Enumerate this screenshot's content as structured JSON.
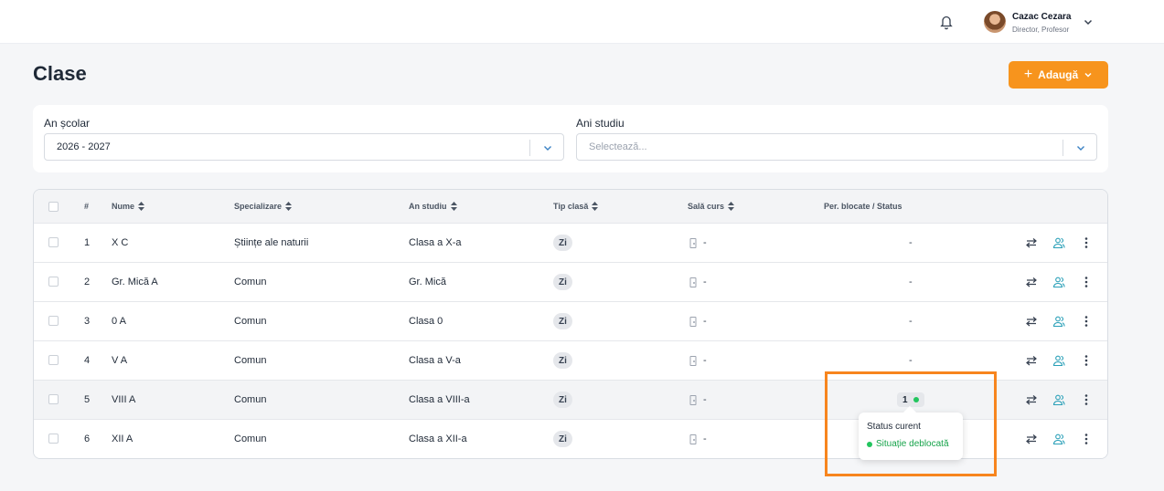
{
  "header": {
    "user_name": "Cazac Cezara",
    "user_role": "Director, Profesor",
    "icons": {
      "notifications": "bell-icon",
      "user_menu": "chevron-down-icon"
    }
  },
  "page": {
    "title": "Clase",
    "add_label": "Adaugă"
  },
  "filters": {
    "school_year": {
      "label": "An școlar",
      "value": "2026 - 2027"
    },
    "study_years": {
      "label": "Ani studiu",
      "placeholder": "Selectează..."
    }
  },
  "table": {
    "columns": {
      "index": "#",
      "name": "Nume",
      "specialization": "Specializare",
      "study_year": "An studiu",
      "class_type": "Tip clasă",
      "room": "Sală curs",
      "status": "Per. blocate / Status"
    },
    "rows": [
      {
        "index": "1",
        "name": "X C",
        "specialization": "Științe ale naturii",
        "study_year": "Clasa a X-a",
        "class_type": "Zi",
        "room": "-",
        "status": "-"
      },
      {
        "index": "2",
        "name": "Gr. Mică A",
        "specialization": "Comun",
        "study_year": "Gr. Mică",
        "class_type": "Zi",
        "room": "-",
        "status": "-"
      },
      {
        "index": "3",
        "name": "0 A",
        "specialization": "Comun",
        "study_year": "Clasa 0",
        "class_type": "Zi",
        "room": "-",
        "status": "-"
      },
      {
        "index": "4",
        "name": "V A",
        "specialization": "Comun",
        "study_year": "Clasa a V-a",
        "class_type": "Zi",
        "room": "-",
        "status": "-"
      },
      {
        "index": "5",
        "name": "VIII A",
        "specialization": "Comun",
        "study_year": "Clasa a VIII-a",
        "class_type": "Zi",
        "room": "-",
        "status_count": "1"
      },
      {
        "index": "6",
        "name": "XII A",
        "specialization": "Comun",
        "study_year": "Clasa a XII-a",
        "class_type": "Zi",
        "room": "-",
        "status": "-"
      }
    ]
  },
  "tooltip": {
    "title": "Status curent",
    "status": "Situație deblocată",
    "status_color": "#16a34a"
  },
  "colors": {
    "accent": "#f7941d",
    "highlight": "#f7851e",
    "teal": "#2aa0b8"
  }
}
